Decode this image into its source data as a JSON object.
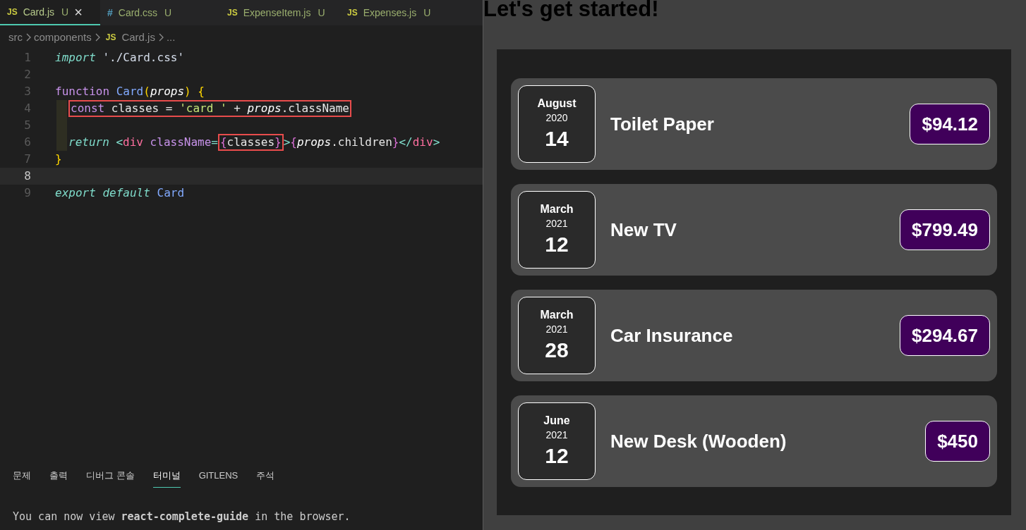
{
  "editor_tabs": [
    {
      "icon": "JS",
      "kind": "js",
      "label": "Card.js",
      "badge": "U",
      "close": "×",
      "selected": true
    },
    {
      "icon": "#",
      "kind": "css",
      "label": "Card.css",
      "badge": "U",
      "selected": false
    },
    {
      "icon": "JS",
      "kind": "js",
      "label": "ExpenseItem.js",
      "badge": "U",
      "selected": false
    },
    {
      "icon": "JS",
      "kind": "js",
      "label": "Expenses.js",
      "badge": "U",
      "selected": false
    }
  ],
  "breadcrumb": {
    "folders": [
      "src",
      "components"
    ],
    "file_icon": "JS",
    "file": "Card.js",
    "more": "..."
  },
  "code_lines": [
    {
      "number": "1",
      "indented": false,
      "current": false,
      "groups": [
        {
          "boxed": false,
          "tokens": [
            {
              "t": "import",
              "kind": "kw"
            },
            {
              "t": " './Card.css'",
              "kind": "str"
            }
          ]
        }
      ]
    },
    {
      "number": "2",
      "indented": false,
      "current": false
    },
    {
      "number": "3",
      "indented": false,
      "current": false,
      "groups": [
        {
          "boxed": false,
          "tokens": [
            {
              "t": "function ",
              "kind": "fn"
            },
            {
              "t": "Card",
              "kind": "name"
            },
            {
              "t": "(",
              "kind": "paren"
            },
            {
              "t": "props",
              "kind": "param"
            },
            {
              "t": ") {",
              "kind": "paren"
            }
          ]
        }
      ]
    },
    {
      "number": "4",
      "indented": true,
      "current": false,
      "groups": [
        {
          "boxed": true,
          "tokens": [
            {
              "t": "const",
              "kind": "fn"
            },
            {
              "t": " classes = ",
              "kind": "plain"
            },
            {
              "t": "'card '",
              "kind": "str2"
            },
            {
              "t": " + ",
              "kind": "plain"
            },
            {
              "t": "props",
              "kind": "param"
            },
            {
              "t": ".className",
              "kind": "plain"
            }
          ]
        }
      ]
    },
    {
      "number": "5",
      "indented": true,
      "current": false
    },
    {
      "number": "6",
      "indented": true,
      "current": false,
      "groups": [
        {
          "boxed": false,
          "tokens": [
            {
              "t": "return ",
              "kind": "kw"
            },
            {
              "t": "<",
              "kind": "punct"
            },
            {
              "t": "div ",
              "kind": "tag"
            },
            {
              "t": "className",
              "kind": "fn"
            },
            {
              "t": "=",
              "kind": "punct"
            }
          ]
        },
        {
          "boxed": true,
          "tokens": [
            {
              "t": "{",
              "kind": "brace"
            },
            {
              "t": "classes",
              "kind": "plain"
            },
            {
              "t": "}",
              "kind": "brace"
            }
          ]
        },
        {
          "boxed": false,
          "tokens": [
            {
              "t": ">",
              "kind": "punct"
            },
            {
              "t": "{",
              "kind": "brace"
            },
            {
              "t": "props",
              "kind": "param"
            },
            {
              "t": ".children",
              "kind": "plain"
            },
            {
              "t": "}",
              "kind": "brace"
            },
            {
              "t": "</",
              "kind": "punct"
            },
            {
              "t": "div",
              "kind": "tag"
            },
            {
              "t": ">",
              "kind": "punct"
            }
          ]
        }
      ]
    },
    {
      "number": "7",
      "indented": false,
      "current": false,
      "groups": [
        {
          "boxed": false,
          "tokens": [
            {
              "t": "}",
              "kind": "paren"
            }
          ]
        }
      ]
    },
    {
      "number": "8",
      "indented": false,
      "current": true
    },
    {
      "number": "9",
      "indented": false,
      "current": false,
      "groups": [
        {
          "boxed": false,
          "tokens": [
            {
              "t": "export default ",
              "kind": "kw"
            },
            {
              "t": "Card",
              "kind": "name"
            }
          ]
        }
      ]
    }
  ],
  "panel_tabs": [
    {
      "label": "문제",
      "selected": false
    },
    {
      "label": "출력",
      "selected": false
    },
    {
      "label": "디버그 콘솔",
      "selected": false
    },
    {
      "label": "터미널",
      "selected": true
    },
    {
      "label": "GITLENS",
      "selected": false
    },
    {
      "label": "주석",
      "selected": false
    }
  ],
  "terminal_text": "You can now view **react-complete-guide** in the browser.",
  "app": {
    "heading": "Let's get started!",
    "expenses": [
      {
        "month": "August",
        "year": "2020",
        "day": "14",
        "title": "Toilet Paper",
        "amount": "$94.12"
      },
      {
        "month": "March",
        "year": "2021",
        "day": "12",
        "title": "New TV",
        "amount": "$799.49"
      },
      {
        "month": "March",
        "year": "2021",
        "day": "28",
        "title": "Car Insurance",
        "amount": "$294.67"
      },
      {
        "month": "June",
        "year": "2021",
        "day": "12",
        "title": "New Desk (Wooden)",
        "amount": "$450"
      }
    ]
  }
}
